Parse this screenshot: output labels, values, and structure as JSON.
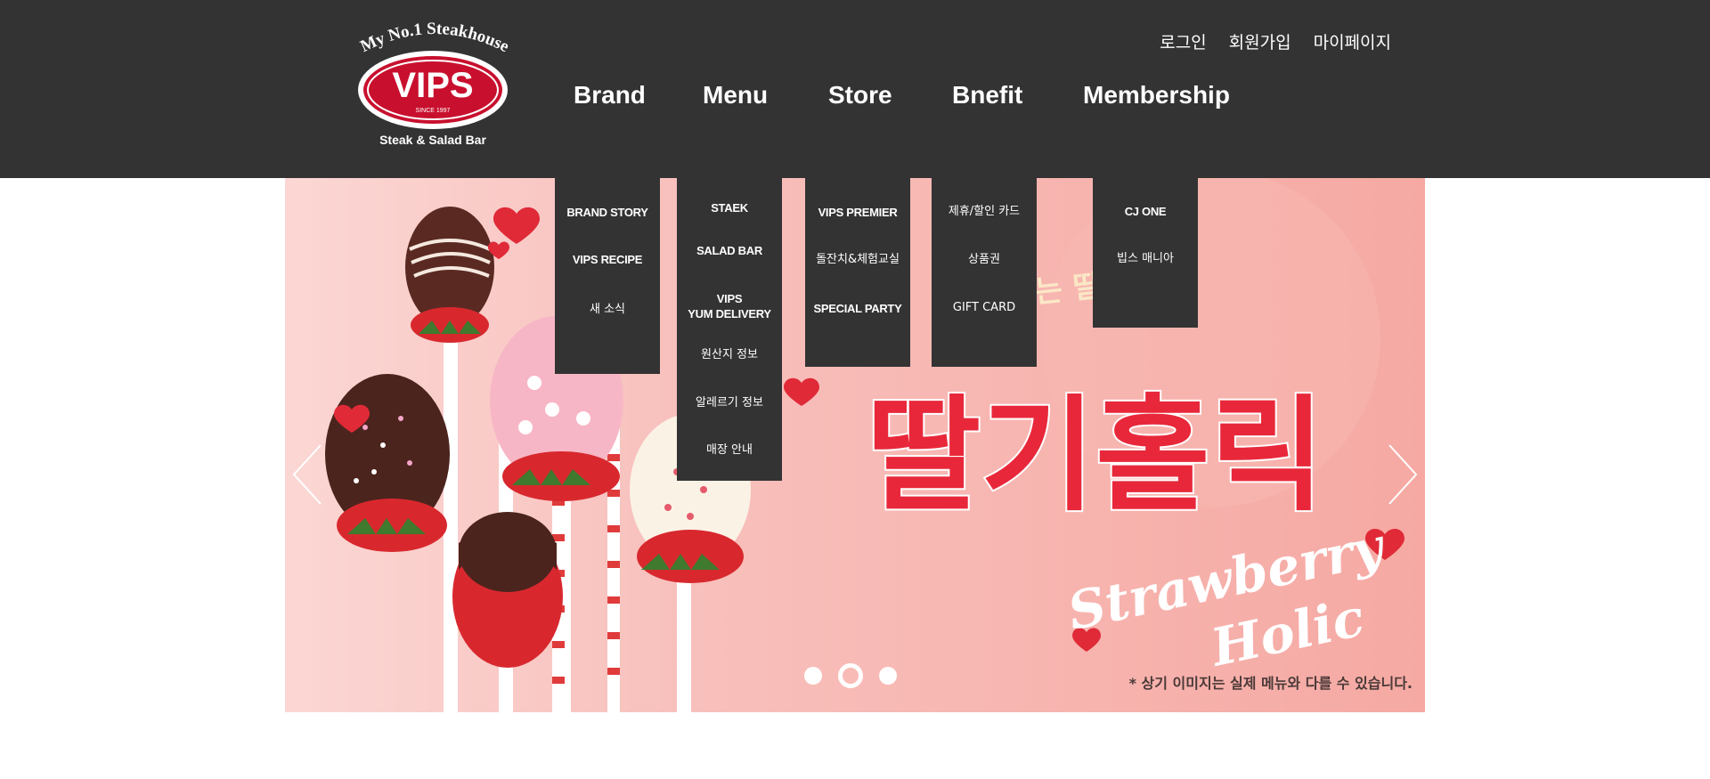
{
  "header": {
    "logo": {
      "tagline": "My No.1 Steakhouse",
      "brand": "VIPS",
      "since": "SINCE 1997",
      "sub": "Steak & Salad Bar"
    },
    "util_links": [
      "로그인",
      "회원가입",
      "마이페이지"
    ],
    "gnb": [
      "Brand",
      "Menu",
      "Store",
      "Bnefit",
      "Membership"
    ]
  },
  "submenus": {
    "brand": [
      "BRAND STORY",
      "VIPS RECIPE",
      "새 소식"
    ],
    "menu": [
      "STAEK",
      "SALAD BAR",
      "VIPS\nYUM DELIVERY",
      "원산지 정보",
      "알레르기 정보",
      "매장 안내"
    ],
    "store": [
      "VIPS PREMIER",
      "돌잔치&체험교실",
      "SPECIAL PARTY"
    ],
    "benefit": [
      "제휴/할인 카드",
      "상품권",
      "GIFT CARD"
    ],
    "membership": [
      "CJ ONE",
      "빕스 매니아"
    ]
  },
  "banner": {
    "headline": "딸기홀릭",
    "subhead": "함께하는 딸기시즌",
    "script_line1": "Strawberry",
    "script_line2": "Holic",
    "caption": "* 상기 이미지는 실제 메뉴와 다를 수 있습니다.",
    "slide_count": 3,
    "active_slide": 2
  },
  "colors": {
    "header_bg": "#333334",
    "submenu_bg": "#333334",
    "brand_red": "#c8102e",
    "headline_red": "#e8283a",
    "banner_pink": "#f6a9a3"
  }
}
